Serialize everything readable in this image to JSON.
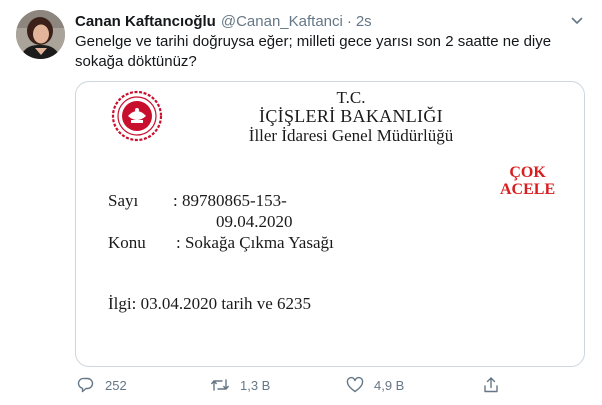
{
  "tweet": {
    "author_name": "Canan Kaftancıoğlu",
    "handle": "@Canan_Kaftanci",
    "separator": "·",
    "time": "2s",
    "text": "Genelge ve tarihi doğruysa eğer; milleti gece yarısı son 2 saatte  ne diye sokağa döktünüz?"
  },
  "document": {
    "header_tc": "T.C.",
    "ministry": "İÇİŞLERİ BAKANLIĞI",
    "directorate": "İller İdaresi Genel Müdürlüğü",
    "urgent_line1": "ÇOK",
    "urgent_line2": "ACELE",
    "sayi_label": "Sayı",
    "sayi_value": ": 89780865-153-",
    "sayi_date": "09.04.2020",
    "konu_label": "Konu",
    "konu_value": ": Sokağa Çıkma Yasağı",
    "ilgi": "İlgi: 03.04.2020 tarih ve 6235"
  },
  "actions": {
    "reply_count": "252",
    "retweet_count": "1,3 B",
    "like_count": "4,9 B"
  },
  "icons": [
    "chevron-down-icon",
    "reply-icon",
    "retweet-icon",
    "like-icon",
    "share-icon",
    "ministry-emblem-icon"
  ],
  "colors": {
    "text": "#14171a",
    "secondary": "#657786",
    "border": "#ccd6dd",
    "stamp_red": "#d81e1e",
    "emblem_red": "#c8102e"
  }
}
